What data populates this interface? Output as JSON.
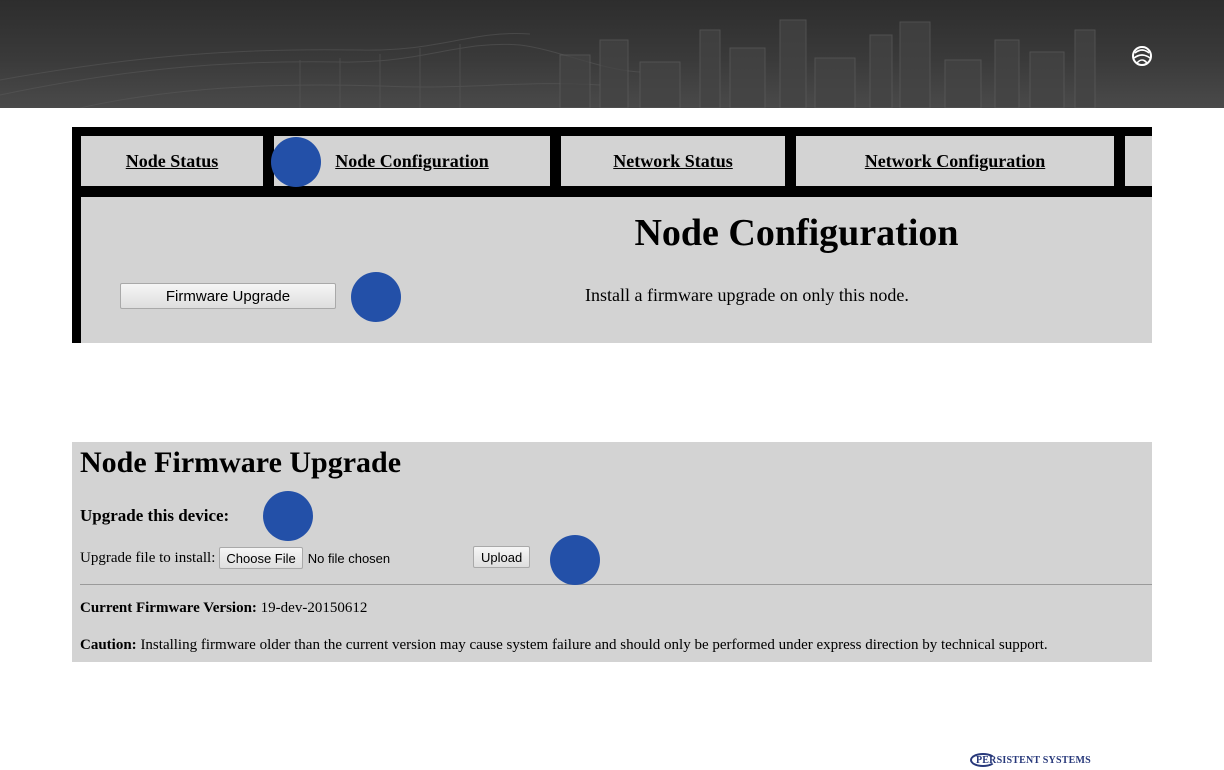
{
  "tabs": [
    {
      "label": "Node Status"
    },
    {
      "label": "Node Configuration"
    },
    {
      "label": "Network Status"
    },
    {
      "label": "Network Configuration"
    }
  ],
  "node_config": {
    "title": "Node Configuration",
    "firmware_button": "Firmware Upgrade",
    "firmware_description": "Install a firmware upgrade on only this node."
  },
  "firmware_upgrade": {
    "title": "Node Firmware Upgrade",
    "subtitle": "Upgrade this device:",
    "file_label": "Upgrade file to install:",
    "choose_button": "Choose File",
    "no_file": "No file chosen",
    "upload_button": "Upload",
    "version_label": "Current Firmware Version:",
    "version_value": "19-dev-20150612",
    "caution_label": "Caution:",
    "caution_text": "Installing firmware older than the current version may cause system failure and should only be performed under express direction by technical support."
  },
  "footer": {
    "brand": "PERSISTENT SYSTEMS"
  },
  "colors": {
    "marker": "#2350a8",
    "panel": "#d3d3d3",
    "brand": "#27387a"
  }
}
